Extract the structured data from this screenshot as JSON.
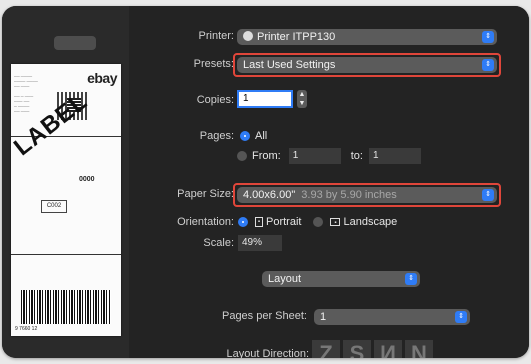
{
  "printer": {
    "label": "Printer:",
    "value": "Printer ITPP130",
    "icon": "printer-icon"
  },
  "presets": {
    "label": "Presets:",
    "value": "Last Used Settings"
  },
  "copies": {
    "label": "Copies:",
    "value": "1"
  },
  "pages": {
    "label": "Pages:",
    "all": "All",
    "from": "From:",
    "from_value": "1",
    "to": "to:",
    "to_value": "1"
  },
  "paper_size": {
    "label": "Paper Size:",
    "value": "4.00x6.00\"",
    "detail": "3.93 by 5.90 inches"
  },
  "orientation": {
    "label": "Orientation:",
    "portrait": "Portrait",
    "landscape": "Landscape"
  },
  "scale": {
    "label": "Scale:",
    "value": "49%"
  },
  "section": {
    "value": "Layout"
  },
  "pages_per_sheet": {
    "label": "Pages per Sheet:",
    "value": "1"
  },
  "layout_direction": {
    "label": "Layout Direction:",
    "glyphs": [
      "Z",
      "S",
      "И",
      "N"
    ]
  },
  "preview": {
    "logo": "ebay",
    "big_word": "LABEL",
    "code1": "0000",
    "code2": "C002",
    "barcode_number": "9 7660 12"
  },
  "colors": {
    "accent": "#2f7cf6",
    "highlight": "#e0463a",
    "panel": "#232323"
  }
}
